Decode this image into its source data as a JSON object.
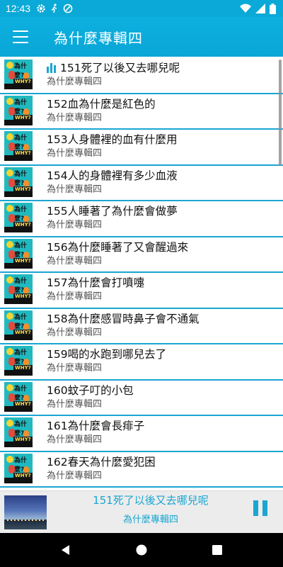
{
  "status_bar": {
    "time": "12:43",
    "icons_left": [
      "gear-icon",
      "walk-icon",
      "dnd-icon"
    ],
    "icons_right": [
      "wifi-icon",
      "signal-icon",
      "battery-icon"
    ]
  },
  "app_bar": {
    "title": "為什麼專輯四",
    "menu_icon": "hamburger-menu-icon"
  },
  "accent_color": "#1aa6d1",
  "list": {
    "items": [
      {
        "title": "151死了以後又去哪兒呢",
        "subtitle": "為什麼專輯四",
        "playing": true
      },
      {
        "title": "152血為什麼是紅色的",
        "subtitle": "為什麼專輯四",
        "playing": false
      },
      {
        "title": "153人身體裡的血有什麼用",
        "subtitle": "為什麼專輯四",
        "playing": false
      },
      {
        "title": "154人的身體裡有多少血液",
        "subtitle": "為什麼專輯四",
        "playing": false
      },
      {
        "title": "155人睡著了為什麼會做夢",
        "subtitle": "為什麼專輯四",
        "playing": false
      },
      {
        "title": "156為什麼睡著了又會醒過來",
        "subtitle": "為什麼專輯四",
        "playing": false
      },
      {
        "title": "157為什麼會打噴嚏",
        "subtitle": "為什麼專輯四",
        "playing": false
      },
      {
        "title": "158為什麼感冒時鼻子會不通氣",
        "subtitle": "為什麼專輯四",
        "playing": false
      },
      {
        "title": "159喝的水跑到哪兒去了",
        "subtitle": "為什麼專輯四",
        "playing": false
      },
      {
        "title": "160蚊子叮的小包",
        "subtitle": "為什麼專輯四",
        "playing": false
      },
      {
        "title": "161為什麼會長痱子",
        "subtitle": "為什麼專輯四",
        "playing": false
      },
      {
        "title": "162春天為什麼愛犯困",
        "subtitle": "為什麼專輯四",
        "playing": false
      }
    ]
  },
  "thumbnail": {
    "question_text": "為什麼?",
    "why_text": "WHY?"
  },
  "player": {
    "title": "151死了以後又去哪兒呢",
    "subtitle": "為什麼專輯四",
    "control_icon": "pause-icon"
  },
  "nav_bar": {
    "icons": [
      "back-icon",
      "home-icon",
      "recents-icon"
    ]
  }
}
